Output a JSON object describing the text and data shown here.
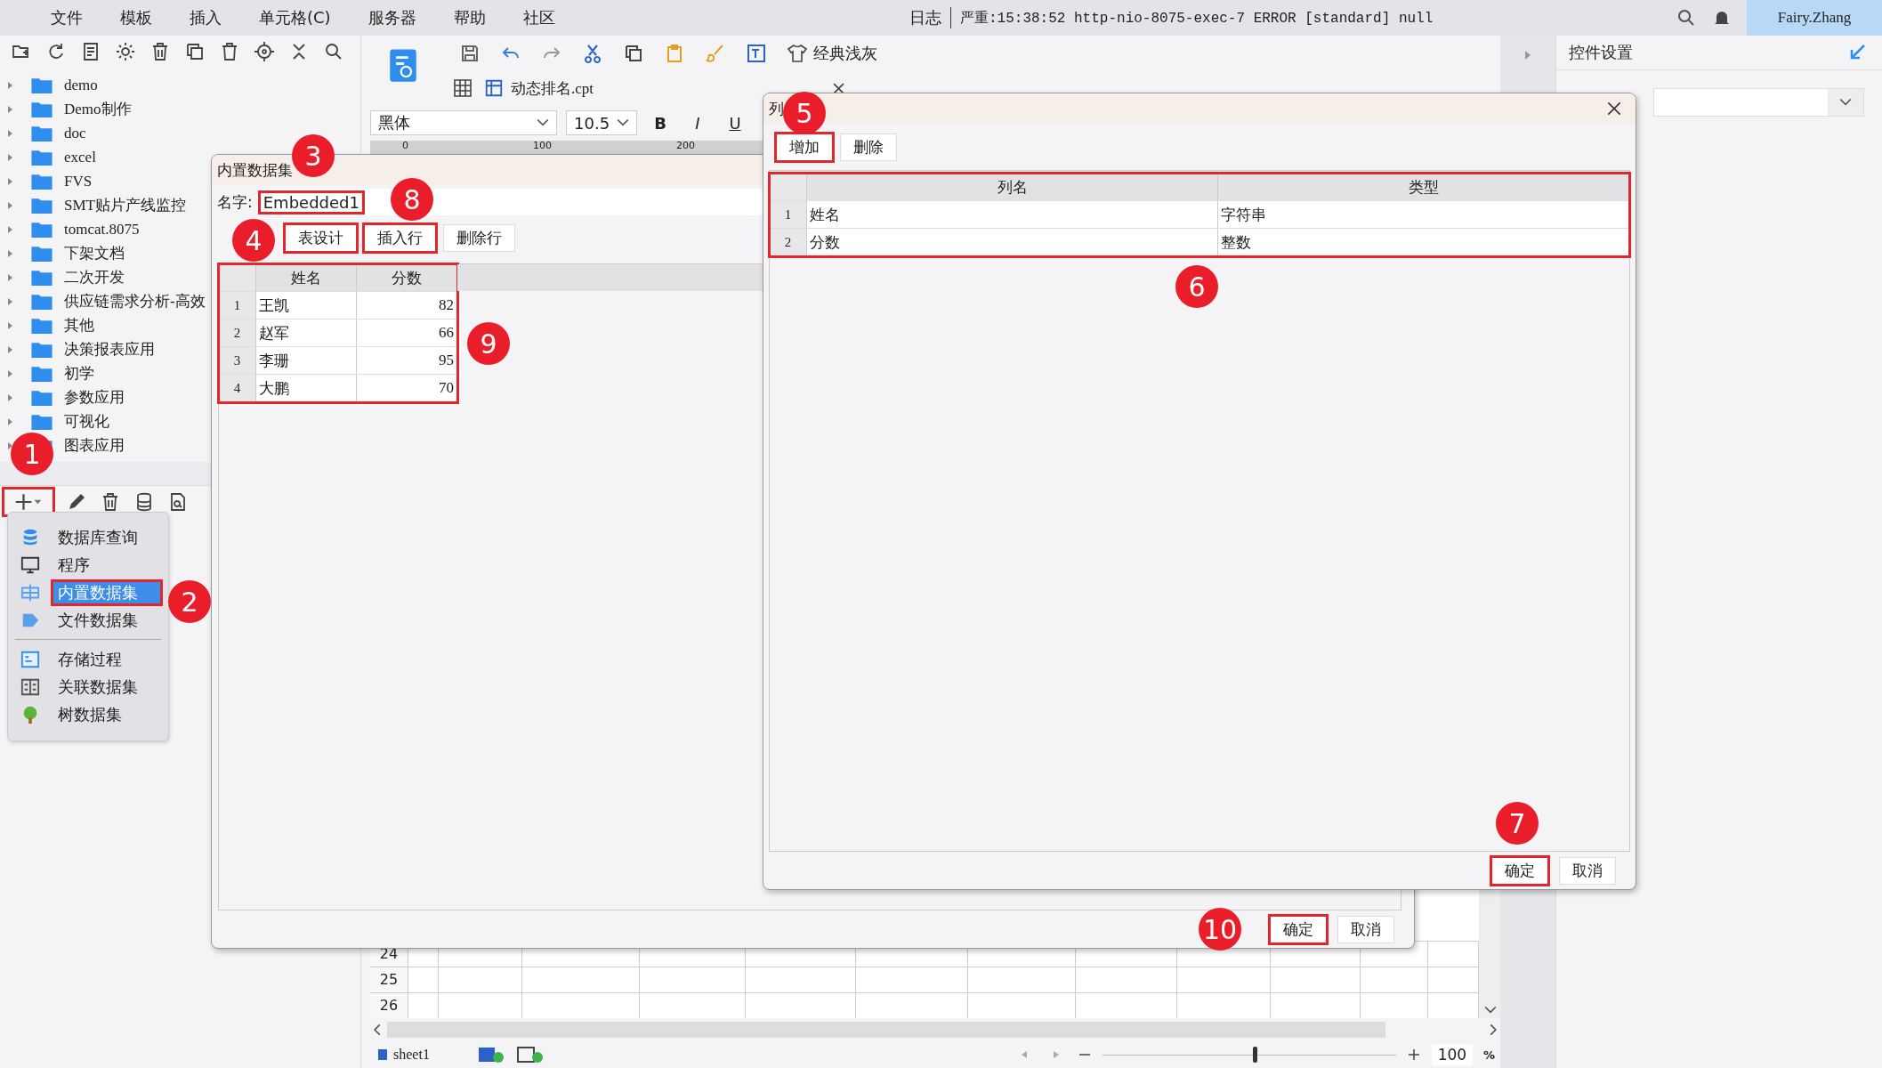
{
  "menu_bar": {
    "items": [
      "文件",
      "模板",
      "插入",
      "单元格(C)",
      "服务器",
      "帮助",
      "社区"
    ],
    "log_label": "日志",
    "log_message": "严重:15:38:52 http-nio-8075-exec-7 ERROR [standard] null",
    "user": "Fairy.Zhang"
  },
  "file_tree": {
    "items": [
      "demo",
      "Demo制作",
      "doc",
      "excel",
      "FVS",
      "SMT贴片产线监控",
      "tomcat.8075",
      "下架文档",
      "二次开发",
      "供应链需求分析-高效",
      "其他",
      "决策报表应用",
      "初学",
      "参数应用",
      "可视化",
      "图表应用"
    ]
  },
  "dataset_toolbar": {
    "add_highlighted": true
  },
  "dataset_menu": {
    "groups": [
      [
        {
          "label": "数据库查询",
          "kind": "database",
          "selected": false,
          "highlighted": false
        },
        {
          "label": "程序",
          "kind": "program",
          "selected": false,
          "highlighted": false
        },
        {
          "label": "内置数据集",
          "kind": "embedded",
          "selected": true,
          "highlighted": true
        },
        {
          "label": "文件数据集",
          "kind": "file",
          "selected": false,
          "highlighted": false
        }
      ],
      [
        {
          "label": "存储过程",
          "kind": "procedure",
          "selected": false,
          "highlighted": false
        },
        {
          "label": "关联数据集",
          "kind": "relation",
          "selected": false,
          "highlighted": false
        },
        {
          "label": "树数据集",
          "kind": "tree",
          "selected": false,
          "highlighted": false
        }
      ]
    ]
  },
  "editor": {
    "style_name": "经典浅灰",
    "tab": "动态排名.cpt",
    "font": "黑体",
    "font_size": "10.5",
    "format_buttons": [
      "B",
      "I",
      "U"
    ],
    "ruler": [
      "0",
      "100",
      "200"
    ],
    "row_numbers": [
      "24",
      "25",
      "26"
    ],
    "sheet": "sheet1",
    "zoom_slider": {
      "level": 0.52
    },
    "zoom": "100",
    "zoom_unit": "%"
  },
  "right_panel": {
    "title": "控件设置"
  },
  "dataset_dialog": {
    "title": "内置数据集",
    "name_label": "名字:",
    "name_value": "Embedded1",
    "name_highlighted": true,
    "buttons": [
      {
        "label": "表设计",
        "highlighted": true
      },
      {
        "label": "插入行",
        "highlighted": true
      },
      {
        "label": "删除行",
        "highlighted": false
      }
    ],
    "table": {
      "highlighted": true,
      "columns": [
        "姓名",
        "分数"
      ],
      "rows": [
        {
          "index": "1",
          "cells": [
            "王凯",
            "82"
          ]
        },
        {
          "index": "2",
          "cells": [
            "赵军",
            "66"
          ]
        },
        {
          "index": "3",
          "cells": [
            "李珊",
            "95"
          ]
        },
        {
          "index": "4",
          "cells": [
            "大鹏",
            "70"
          ]
        }
      ]
    },
    "footer": [
      {
        "label": "确定",
        "highlighted": true
      },
      {
        "label": "取消",
        "highlighted": false
      }
    ]
  },
  "column_dialog": {
    "title": "列",
    "buttons": [
      {
        "label": "增加",
        "highlighted": true
      },
      {
        "label": "删除",
        "highlighted": false
      }
    ],
    "table": {
      "highlighted": true,
      "columns": [
        "列名",
        "类型"
      ],
      "rows": [
        {
          "index": "1",
          "cells": [
            "姓名",
            "字符串"
          ]
        },
        {
          "index": "2",
          "cells": [
            "分数",
            "整数"
          ]
        }
      ]
    },
    "footer": [
      {
        "label": "确定",
        "highlighted": true
      },
      {
        "label": "取消",
        "highlighted": false
      }
    ]
  },
  "callouts": [
    "1",
    "2",
    "3",
    "4",
    "5",
    "6",
    "7",
    "8",
    "9",
    "10"
  ]
}
